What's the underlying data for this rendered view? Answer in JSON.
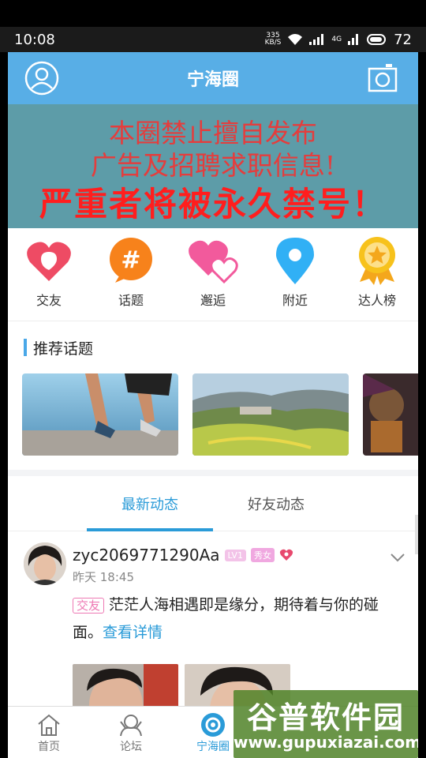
{
  "status_bar": {
    "time": "10:08",
    "speed_top": "335",
    "speed_bottom": "KB/S",
    "signal": "4G",
    "battery": "72"
  },
  "header": {
    "title": "宁海圈"
  },
  "banner": {
    "line1": "本圈禁止擅自发布",
    "line2": "广告及招聘求职信息!",
    "line3": "严重者将被永久禁号！"
  },
  "quick_links": [
    {
      "label": "交友",
      "icon": "heart-chat-icon",
      "color": "#ee4b64"
    },
    {
      "label": "话题",
      "icon": "hashtag-icon",
      "color": "#f7821b"
    },
    {
      "label": "邂逅",
      "icon": "double-heart-icon",
      "color": "#f25a9c"
    },
    {
      "label": "附近",
      "icon": "location-pin-icon",
      "color": "#31b0f5"
    },
    {
      "label": "达人榜",
      "icon": "star-medal-icon",
      "color": "#f7b81c"
    }
  ],
  "recommended": {
    "title": "推荐话题"
  },
  "tabs": [
    {
      "label": "最新动态"
    },
    {
      "label": "好友动态"
    }
  ],
  "post": {
    "username": "zyc2069771290Aa",
    "level_badge": "LV1",
    "gender_badge": "秀女",
    "time": "昨天 18:45",
    "tag": "交友",
    "text": "茫茫人海相遇即是缘分，期待着与你的碰面。",
    "more_link": "查看详情"
  },
  "bottom_nav": [
    {
      "label": "首页",
      "icon": "home-icon"
    },
    {
      "label": "论坛",
      "icon": "forum-icon"
    },
    {
      "label": "宁海圈",
      "icon": "circle-icon",
      "active": true
    }
  ],
  "watermark": {
    "line1": "谷普软件园",
    "line2": "www.gupuxiazai.com"
  },
  "colors": {
    "header": "#58aee6",
    "accent": "#2a9bd8",
    "banner_bg": "#5d9ca8",
    "banner_text": "#e43d3d"
  }
}
